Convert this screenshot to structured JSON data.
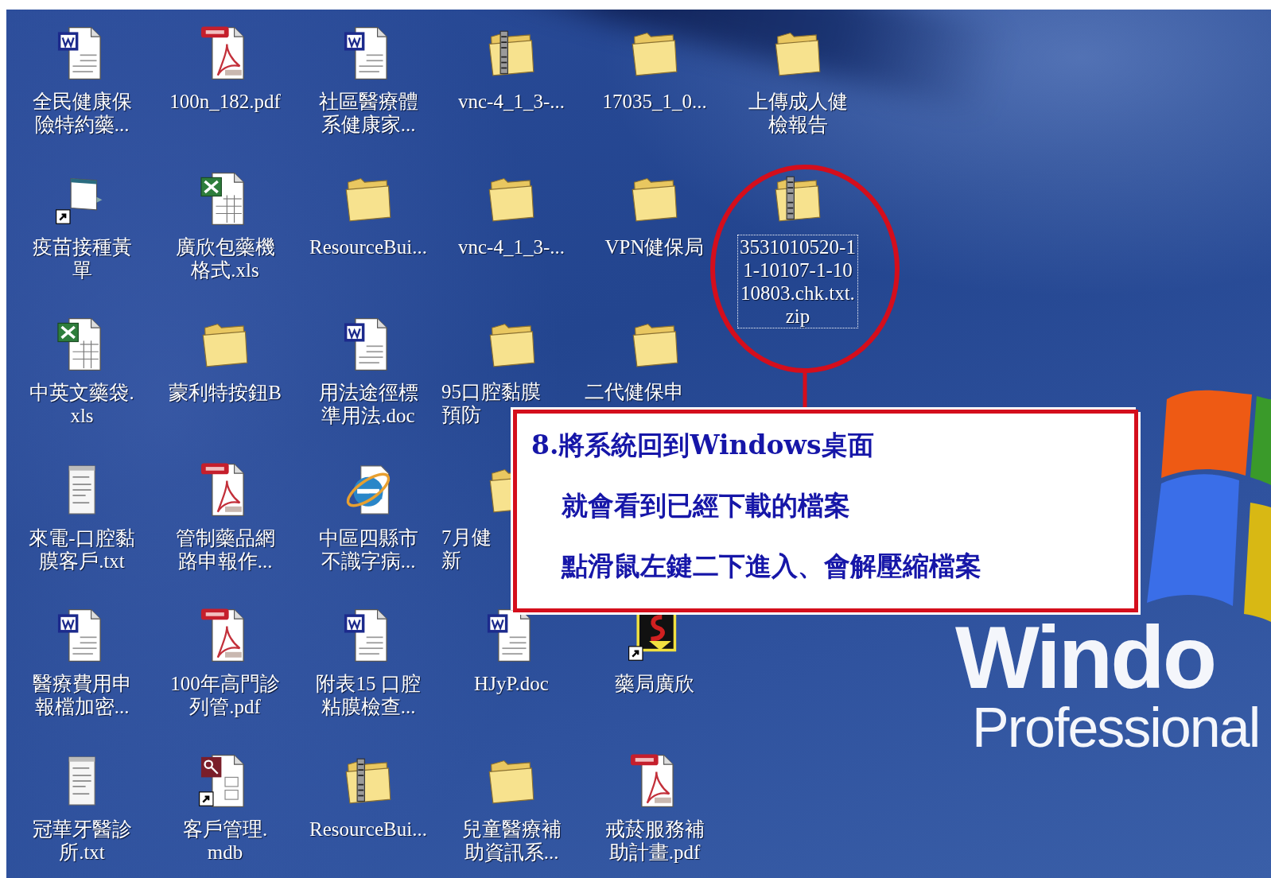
{
  "desktop": {
    "rows": [
      [
        {
          "kind": "word",
          "lines": [
            "全民健康保",
            "險特約藥..."
          ],
          "shortcut": false,
          "selected": false,
          "covered": false
        },
        {
          "kind": "pdf",
          "lines": [
            "100n_182.pdf"
          ],
          "shortcut": false,
          "selected": false,
          "covered": false
        },
        {
          "kind": "word",
          "lines": [
            "社區醫療體",
            "系健康家..."
          ],
          "shortcut": false,
          "selected": false,
          "covered": false
        },
        {
          "kind": "zip",
          "lines": [
            "vnc-4_1_3-..."
          ],
          "shortcut": false,
          "selected": false,
          "covered": false
        },
        {
          "kind": "folder",
          "lines": [
            "17035_1_0..."
          ],
          "shortcut": false,
          "selected": false,
          "covered": false
        },
        {
          "kind": "folder",
          "lines": [
            "上傳成人健",
            "檢報告"
          ],
          "shortcut": false,
          "selected": false,
          "covered": false
        }
      ],
      [
        {
          "kind": "window",
          "lines": [
            "疫苗接種黃",
            "單"
          ],
          "shortcut": true,
          "selected": false,
          "covered": false
        },
        {
          "kind": "excel",
          "lines": [
            "廣欣包藥機",
            "格式.xls"
          ],
          "shortcut": false,
          "selected": false,
          "covered": false
        },
        {
          "kind": "folder",
          "lines": [
            "ResourceBui..."
          ],
          "shortcut": false,
          "selected": false,
          "covered": false
        },
        {
          "kind": "folder",
          "lines": [
            "vnc-4_1_3-..."
          ],
          "shortcut": false,
          "selected": false,
          "covered": false
        },
        {
          "kind": "folder",
          "lines": [
            "VPN健保局"
          ],
          "shortcut": false,
          "selected": false,
          "covered": false
        },
        {
          "kind": "zip",
          "lines": [
            "3531010520-1",
            "1-10107-1-10",
            "10803.chk.txt.",
            "zip"
          ],
          "shortcut": false,
          "selected": true,
          "covered": false
        }
      ],
      [
        {
          "kind": "excel",
          "lines": [
            "中英文藥袋.",
            "xls"
          ],
          "shortcut": false,
          "selected": false,
          "covered": false
        },
        {
          "kind": "folder",
          "lines": [
            "蒙利特按鈕B"
          ],
          "shortcut": false,
          "selected": false,
          "covered": false
        },
        {
          "kind": "word",
          "lines": [
            "用法途徑標",
            "準用法.doc"
          ],
          "shortcut": false,
          "selected": false,
          "covered": false
        },
        {
          "kind": "folder",
          "lines": [
            "95口腔黏膜",
            "預防"
          ],
          "shortcut": false,
          "selected": false,
          "covered": true
        },
        {
          "kind": "folder",
          "lines": [
            "二代健保申"
          ],
          "shortcut": false,
          "selected": false,
          "covered": true
        },
        null
      ],
      [
        {
          "kind": "text",
          "lines": [
            "來電-口腔黏",
            "膜客戶.txt"
          ],
          "shortcut": false,
          "selected": false,
          "covered": false
        },
        {
          "kind": "pdf",
          "lines": [
            "管制藥品網",
            "路申報作..."
          ],
          "shortcut": false,
          "selected": false,
          "covered": false
        },
        {
          "kind": "ie",
          "lines": [
            "中區四縣市",
            "不識字病..."
          ],
          "shortcut": false,
          "selected": false,
          "covered": false
        },
        {
          "kind": "folder",
          "lines": [
            "7月健",
            "新"
          ],
          "shortcut": false,
          "selected": false,
          "covered": true
        },
        null,
        null
      ],
      [
        {
          "kind": "word",
          "lines": [
            "醫療費用申",
            "報檔加密..."
          ],
          "shortcut": false,
          "selected": false,
          "covered": false
        },
        {
          "kind": "pdf",
          "lines": [
            "100年高門診",
            "列管.pdf"
          ],
          "shortcut": false,
          "selected": false,
          "covered": false
        },
        {
          "kind": "word",
          "lines": [
            "附表15 口腔",
            "粘膜檢查..."
          ],
          "shortcut": false,
          "selected": false,
          "covered": false
        },
        {
          "kind": "word",
          "lines": [
            "HJyP.doc"
          ],
          "shortcut": false,
          "selected": false,
          "covered": false
        },
        {
          "kind": "app",
          "lines": [
            "藥局廣欣"
          ],
          "shortcut": true,
          "selected": false,
          "covered": false
        }
      ],
      [
        {
          "kind": "text",
          "lines": [
            "冠華牙醫診",
            "所.txt"
          ],
          "shortcut": false,
          "selected": false,
          "covered": false
        },
        {
          "kind": "access",
          "lines": [
            "客戶管理.",
            "mdb"
          ],
          "shortcut": true,
          "selected": false,
          "covered": false
        },
        {
          "kind": "zip",
          "lines": [
            "ResourceBui..."
          ],
          "shortcut": false,
          "selected": false,
          "covered": false
        },
        {
          "kind": "folder",
          "lines": [
            "兒童醫療補",
            "助資訊系..."
          ],
          "shortcut": false,
          "selected": false,
          "covered": false
        },
        {
          "kind": "pdf",
          "lines": [
            "戒菸服務補",
            "助計畫.pdf"
          ],
          "shortcut": false,
          "selected": false,
          "covered": false
        }
      ]
    ]
  },
  "callout": {
    "heading": "8.將系統回到Windows桌面",
    "lines": [
      "就會看到已經下載的檔案",
      "點滑鼠左鍵二下進入、會解壓縮檔案"
    ]
  },
  "logo": {
    "wordmark": "Windo",
    "edition": "Professional"
  }
}
